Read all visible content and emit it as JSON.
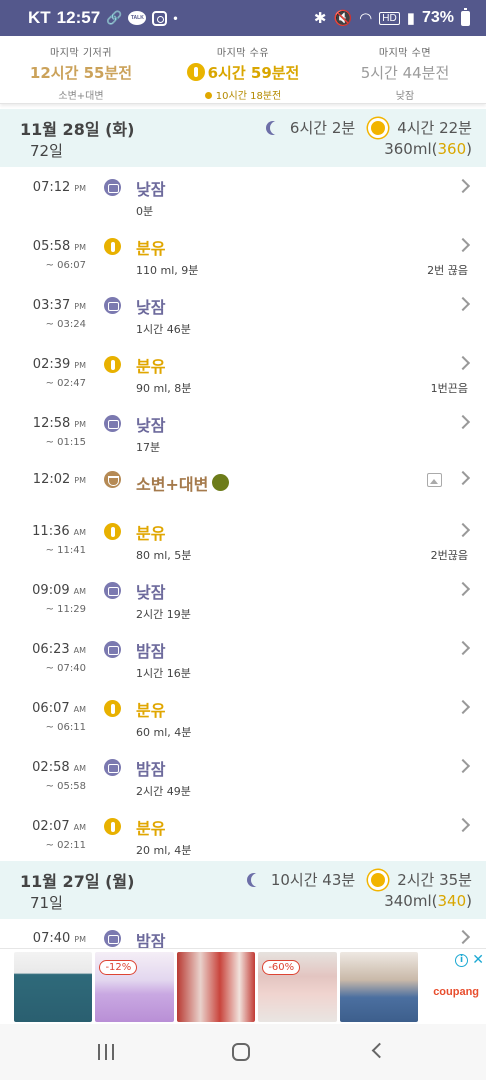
{
  "status_bar": {
    "carrier": "KT",
    "time": "12:57",
    "talk_label": "TALK",
    "battery": "73%"
  },
  "summary": {
    "diaper": {
      "label": "마지막 기저귀",
      "value": "12시간 55분전",
      "sub": "소변+대변"
    },
    "feed": {
      "label": "마지막 수유",
      "value": "6시간 59분전",
      "sub": "10시간 18분전"
    },
    "sleep": {
      "label": "마지막 수면",
      "value": "5시간 44분전",
      "sub": "낮잠"
    }
  },
  "days": [
    {
      "date": "11월 28일 (화)",
      "age": "72일",
      "night_sleep": "6시간 2분",
      "day_sleep": "4시간 22분",
      "ml_total": "360ml",
      "ml_paren": "360"
    },
    {
      "date": "11월 27일 (월)",
      "age": "71일",
      "night_sleep": "10시간 43분",
      "day_sleep": "2시간 35분",
      "ml_total": "340ml",
      "ml_paren": "340"
    }
  ],
  "rows": [
    {
      "time": "07:12",
      "ampm": "PM",
      "end": "",
      "type": "sleep",
      "title": "낮잠",
      "detail": "0분",
      "note": ""
    },
    {
      "time": "05:58",
      "ampm": "PM",
      "end": "~ 06:07",
      "type": "feed",
      "title": "분유",
      "detail": "110 ml, 9분",
      "note": "2번 끊음"
    },
    {
      "time": "03:37",
      "ampm": "PM",
      "end": "~ 03:24",
      "type": "sleep",
      "title": "낮잠",
      "detail": "1시간 46분",
      "note": ""
    },
    {
      "time": "02:39",
      "ampm": "PM",
      "end": "~ 02:47",
      "type": "feed",
      "title": "분유",
      "detail": "90 ml, 8분",
      "note": "1번끈음"
    },
    {
      "time": "12:58",
      "ampm": "PM",
      "end": "~ 01:15",
      "type": "sleep",
      "title": "낮잠",
      "detail": "17분",
      "note": ""
    },
    {
      "time": "12:02",
      "ampm": "PM",
      "end": "",
      "type": "diaper",
      "title": "소변+대변",
      "detail": "",
      "note": ""
    },
    {
      "time": "11:36",
      "ampm": "AM",
      "end": "~ 11:41",
      "type": "feed",
      "title": "분유",
      "detail": "80 ml, 5분",
      "note": "2번끊음"
    },
    {
      "time": "09:09",
      "ampm": "AM",
      "end": "~ 11:29",
      "type": "sleep",
      "title": "낮잠",
      "detail": "2시간 19분",
      "note": ""
    },
    {
      "time": "06:23",
      "ampm": "AM",
      "end": "~ 07:40",
      "type": "sleep",
      "title": "밤잠",
      "detail": "1시간 16분",
      "note": ""
    },
    {
      "time": "06:07",
      "ampm": "AM",
      "end": "~ 06:11",
      "type": "feed",
      "title": "분유",
      "detail": "60 ml, 4분",
      "note": ""
    },
    {
      "time": "02:58",
      "ampm": "AM",
      "end": "~ 05:58",
      "type": "sleep",
      "title": "밤잠",
      "detail": "2시간 49분",
      "note": ""
    },
    {
      "time": "02:07",
      "ampm": "AM",
      "end": "~ 02:11",
      "type": "feed",
      "title": "분유",
      "detail": "20 ml, 4분",
      "note": ""
    },
    {
      "time": "07:40",
      "ampm": "PM",
      "end": "",
      "type": "sleep",
      "title": "밤잠",
      "detail": "",
      "note": ""
    }
  ],
  "ad": {
    "badge_1": "-12%",
    "badge_2": "-60%",
    "brand": "coupang",
    "info": "i",
    "close": "✕"
  },
  "colors": {
    "status_bar": "#54588c",
    "sleep": "#7b79b0",
    "feed": "#e8b100",
    "diaper": "#b58a55",
    "day_header_bg": "#e9f5f5",
    "poop_color": "#6d7c1a"
  }
}
